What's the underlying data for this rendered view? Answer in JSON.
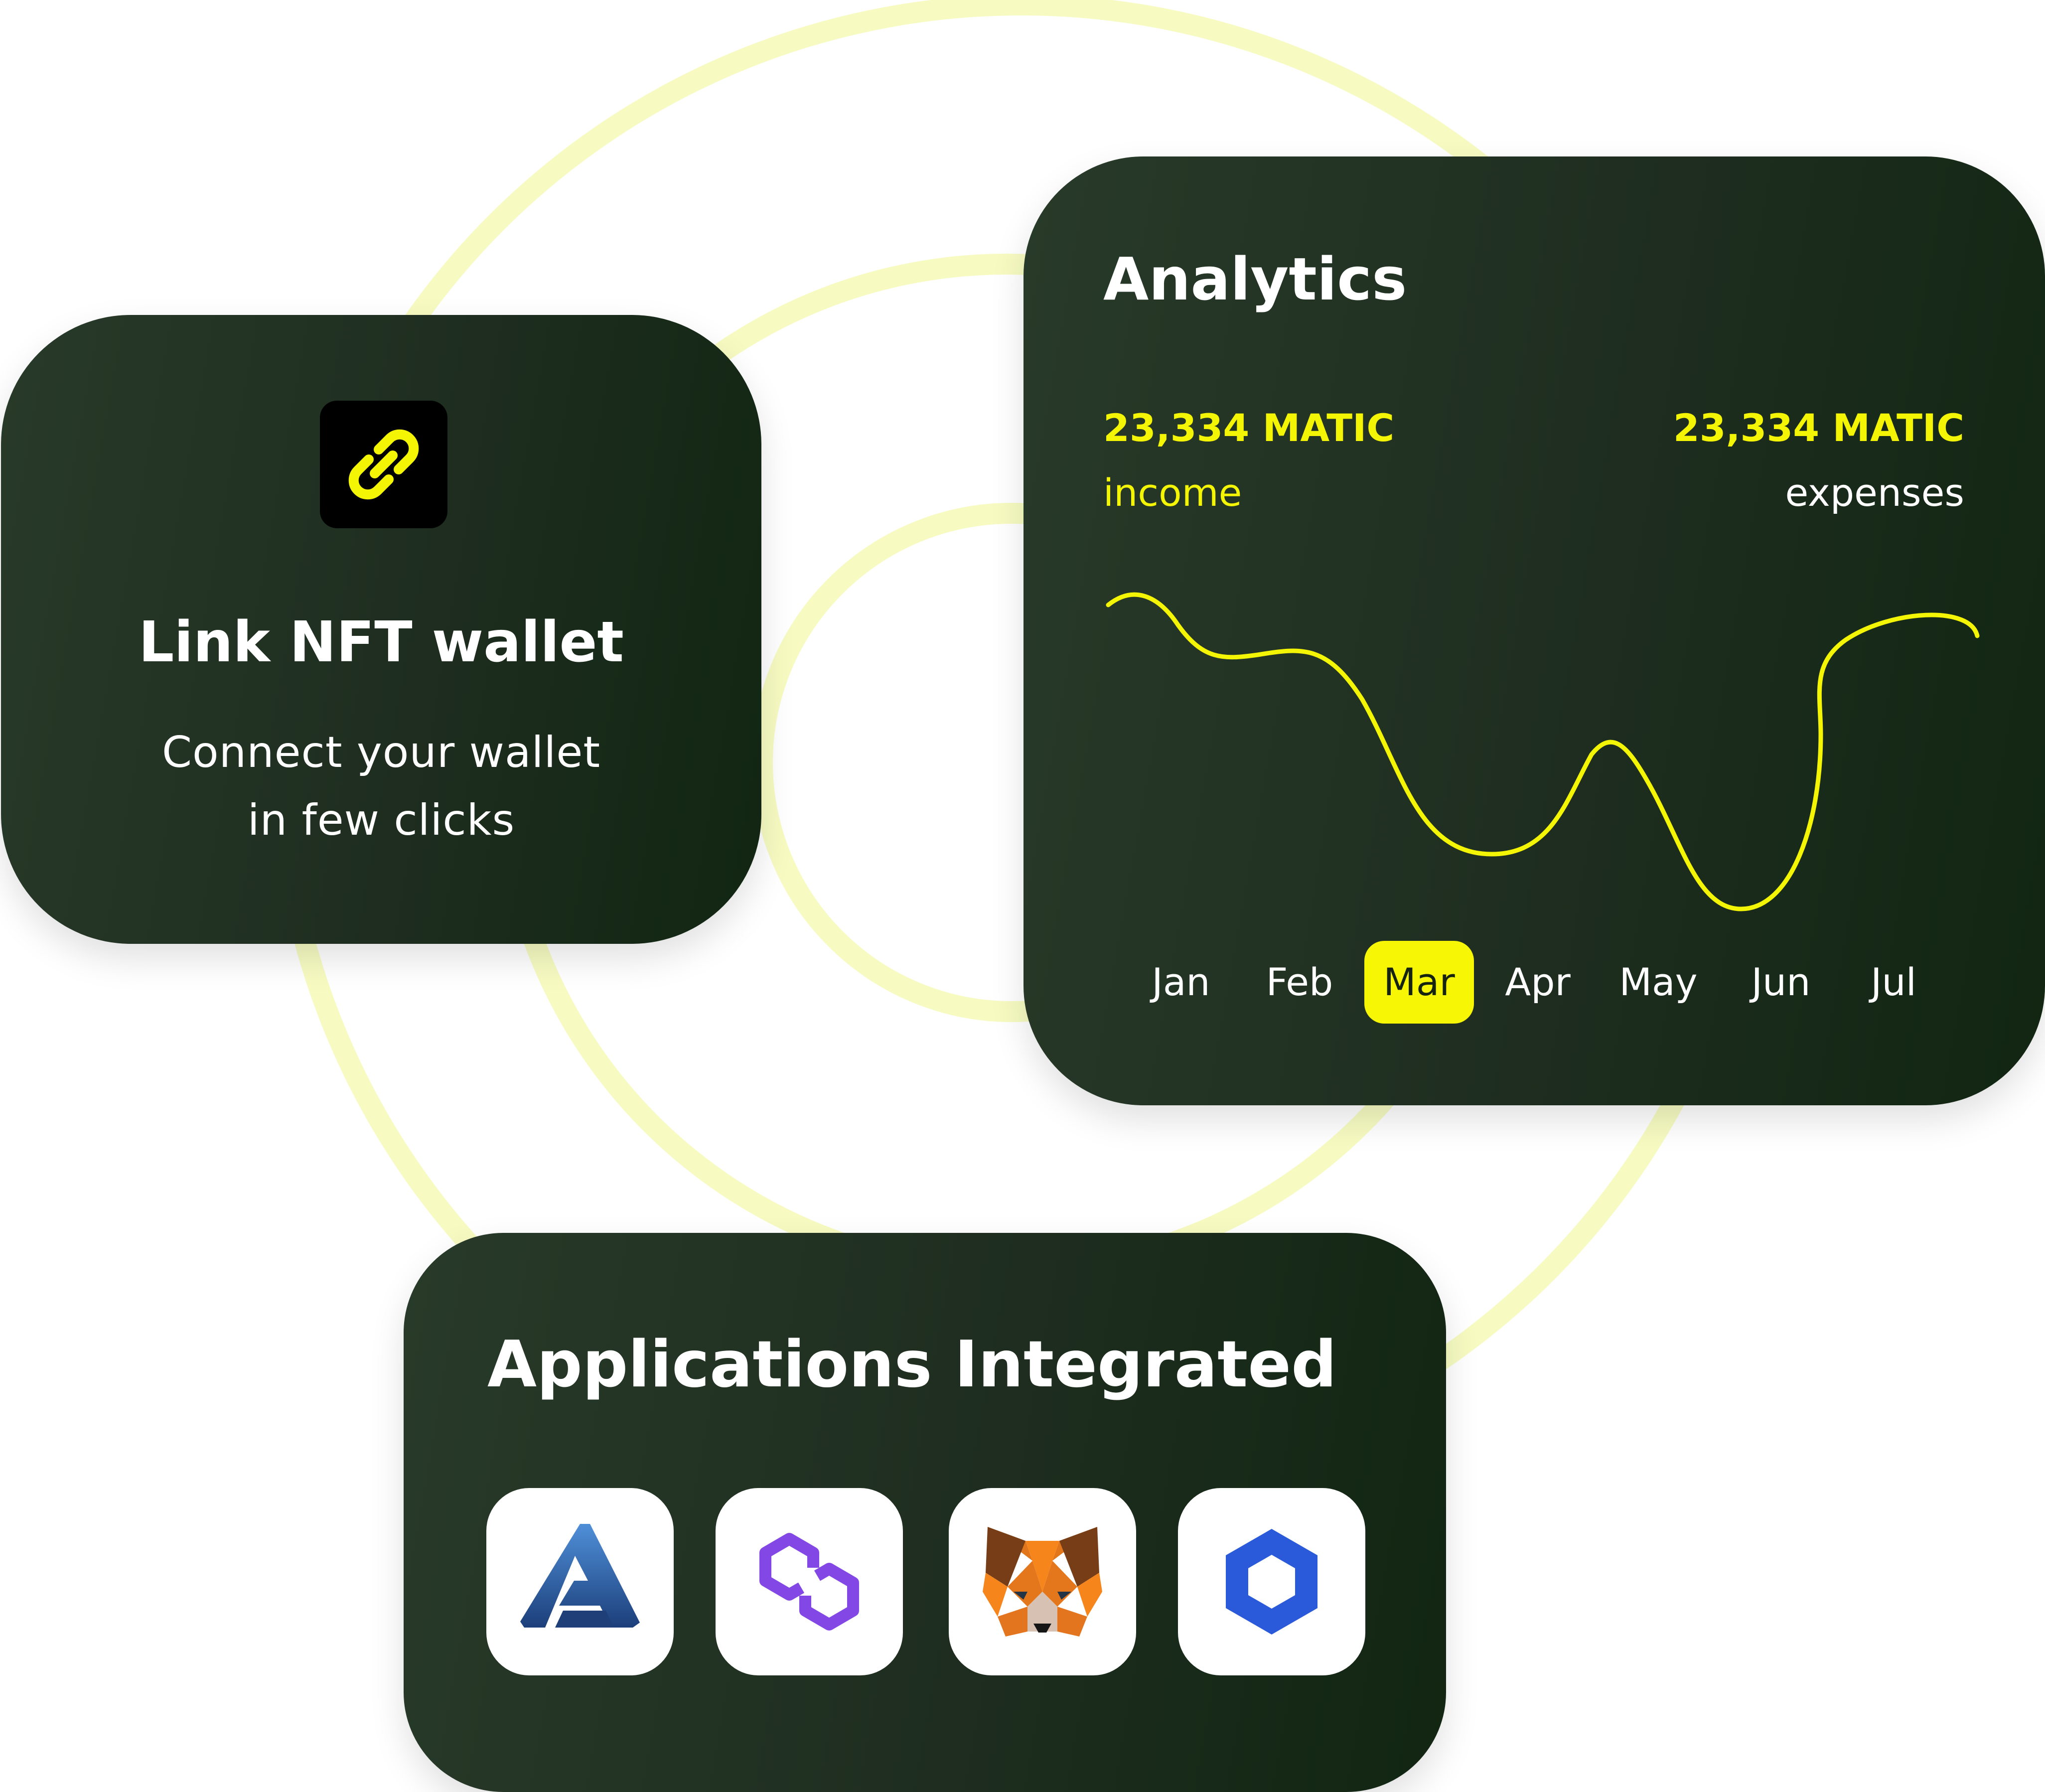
{
  "wallet_card": {
    "title": "Link NFT wallet",
    "description_line1": "Connect your wallet",
    "description_line2": "in few clicks",
    "icon": "link-icon",
    "accent_color": "#f4f405"
  },
  "analytics": {
    "title": "Analytics",
    "income": {
      "value": "23,334 MATIC",
      "label": "income"
    },
    "expenses": {
      "value": "23,334 MATIC",
      "label": "expenses"
    },
    "months": [
      "Jan",
      "Feb",
      "Mar",
      "Apr",
      "May",
      "Jun",
      "Jul"
    ],
    "selected_month": "Mar",
    "line_color": "#f4f405"
  },
  "applications": {
    "title": "Applications Integrated",
    "apps": [
      {
        "icon": "aave-triangle-icon"
      },
      {
        "icon": "polygon-icon",
        "color": "#8247e5"
      },
      {
        "icon": "metamask-fox-icon",
        "color": "#f6851b"
      },
      {
        "icon": "chainlink-icon",
        "color": "#2a5ada"
      }
    ]
  },
  "background": {
    "ring_color": "#f6fbb7"
  }
}
